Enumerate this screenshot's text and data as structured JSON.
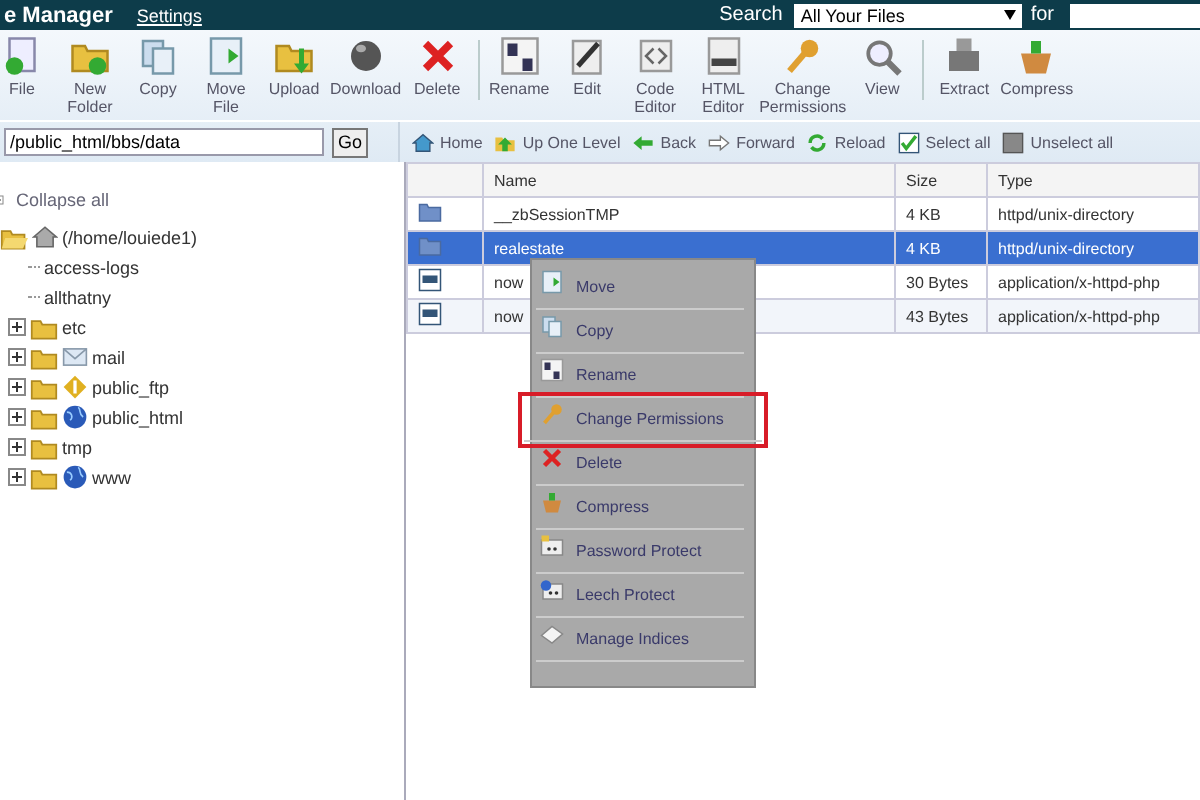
{
  "header": {
    "title": "e Manager",
    "settings_link": "Settings",
    "search_label": "Search",
    "search_scope": "All Your Files",
    "for_label": "for"
  },
  "toolbar": [
    {
      "kind": "file",
      "label": "File"
    },
    {
      "kind": "folder",
      "label": "New Folder"
    },
    {
      "kind": "copy",
      "label": "Copy"
    },
    {
      "kind": "move",
      "label": "Move File"
    },
    {
      "kind": "upload",
      "label": "Upload"
    },
    {
      "kind": "download",
      "label": "Download"
    },
    {
      "kind": "delete",
      "label": "Delete"
    },
    {
      "kind": "divider"
    },
    {
      "kind": "rename",
      "label": "Rename"
    },
    {
      "kind": "edit",
      "label": "Edit"
    },
    {
      "kind": "code",
      "label": "Code Editor"
    },
    {
      "kind": "html",
      "label": "HTML Editor"
    },
    {
      "kind": "key",
      "label": "Change Permissions"
    },
    {
      "kind": "view",
      "label": "View"
    },
    {
      "kind": "divider"
    },
    {
      "kind": "extract",
      "label": "Extract"
    },
    {
      "kind": "compress",
      "label": "Compress"
    }
  ],
  "path": {
    "value": "/public_html/bbs/data",
    "go": "Go"
  },
  "nav": [
    {
      "kind": "home",
      "label": "Home"
    },
    {
      "kind": "up",
      "label": "Up One Level"
    },
    {
      "kind": "back",
      "label": "Back"
    },
    {
      "kind": "forward",
      "label": "Forward"
    },
    {
      "kind": "reload",
      "label": "Reload"
    },
    {
      "kind": "check",
      "label": "Select all"
    },
    {
      "kind": "uncheck",
      "label": "Unselect all"
    }
  ],
  "tree": {
    "collapse_all": "Collapse all",
    "root": {
      "label": "(/home/louiede1)",
      "expanded": true,
      "children": [
        {
          "kind": "link",
          "label": "access-logs"
        },
        {
          "kind": "link",
          "label": "allthatny"
        },
        {
          "kind": "folder",
          "label": "etc",
          "expanded": false
        },
        {
          "kind": "mail",
          "label": "mail",
          "expanded": false
        },
        {
          "kind": "ftp",
          "label": "public_ftp",
          "expanded": false
        },
        {
          "kind": "globe",
          "label": "public_html",
          "expanded": false
        },
        {
          "kind": "folder",
          "label": "tmp",
          "expanded": false
        },
        {
          "kind": "globe",
          "label": "www",
          "expanded": false
        }
      ]
    }
  },
  "table": {
    "columns": [
      "Name",
      "Size",
      "Type"
    ],
    "rows": [
      {
        "kind": "dir",
        "name": "__zbSessionTMP",
        "size": "4 KB",
        "type": "httpd/unix-directory",
        "selected": false
      },
      {
        "kind": "dir",
        "name": "realestate",
        "size": "4 KB",
        "type": "httpd/unix-directory",
        "selected": true
      },
      {
        "kind": "php",
        "name": "now",
        "size": "30 Bytes",
        "type": "application/x-httpd-php",
        "selected": false
      },
      {
        "kind": "php",
        "name": "now",
        "size": "43 Bytes",
        "type": "application/x-httpd-php",
        "selected": false
      }
    ]
  },
  "context_menu": [
    {
      "kind": "move",
      "label": "Move",
      "highlighted": false
    },
    {
      "kind": "copy",
      "label": "Copy",
      "highlighted": false
    },
    {
      "kind": "rename",
      "label": "Rename",
      "highlighted": false
    },
    {
      "kind": "key",
      "label": "Change Permissions",
      "highlighted": true
    },
    {
      "kind": "delete",
      "label": "Delete",
      "highlighted": false
    },
    {
      "kind": "compress",
      "label": "Compress",
      "highlighted": false
    },
    {
      "kind": "lock",
      "label": "Password Protect",
      "highlighted": false
    },
    {
      "kind": "leech",
      "label": "Leech Protect",
      "highlighted": false
    },
    {
      "kind": "index",
      "label": "Manage Indices",
      "highlighted": false
    }
  ]
}
